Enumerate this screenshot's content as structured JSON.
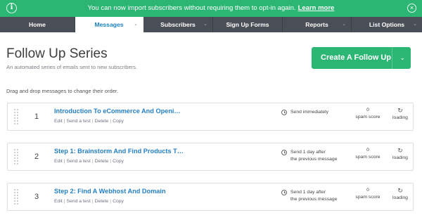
{
  "banner": {
    "message": "You can now import subscribers without requiring them to opt-in again.",
    "link": "Learn more",
    "info_glyph": "i",
    "close_glyph": "×",
    "color": "#2bb673"
  },
  "nav": {
    "tabs": [
      {
        "label": "Home",
        "active": false,
        "dropdown": false
      },
      {
        "label": "Messages",
        "active": true,
        "dropdown": true
      },
      {
        "label": "Subscribers",
        "active": false,
        "dropdown": true
      },
      {
        "label": "Sign Up Forms",
        "active": false,
        "dropdown": false
      },
      {
        "label": "Reports",
        "active": false,
        "dropdown": true
      },
      {
        "label": "List Options",
        "active": false,
        "dropdown": true
      }
    ],
    "chevron": "⌄"
  },
  "page": {
    "title": "Follow Up Series",
    "subtitle": "An automated series of emails sent to new subscribers.",
    "create_button": "Create A Follow Up",
    "create_caret": "⌄",
    "hint": "Drag and drop messages to change their order."
  },
  "row_actions": {
    "edit": "Edit",
    "test": "Send a test",
    "delete": "Delete",
    "copy": "Copy",
    "sep": "|"
  },
  "messages": [
    {
      "number": "1",
      "name": "Introduction To eCommerce And Openi…",
      "timing_line1": "Send immediately",
      "timing_line2": "",
      "spam_value": "0",
      "spam_label": "spam score",
      "status_icon": "↻",
      "status": "loading"
    },
    {
      "number": "2",
      "name": "Step 1: Brainstorm And Find Products T…",
      "timing_line1": "Send 1 day after",
      "timing_line2": "the previous message",
      "spam_value": "0",
      "spam_label": "spam score",
      "status_icon": "↻",
      "status": "loading"
    },
    {
      "number": "3",
      "name": "Step 2: Find A Webhost And Domain",
      "timing_line1": "Send 1 day after",
      "timing_line2": "the previous message",
      "spam_value": "0",
      "spam_label": "spam score",
      "status_icon": "↻",
      "status": "loading"
    }
  ]
}
